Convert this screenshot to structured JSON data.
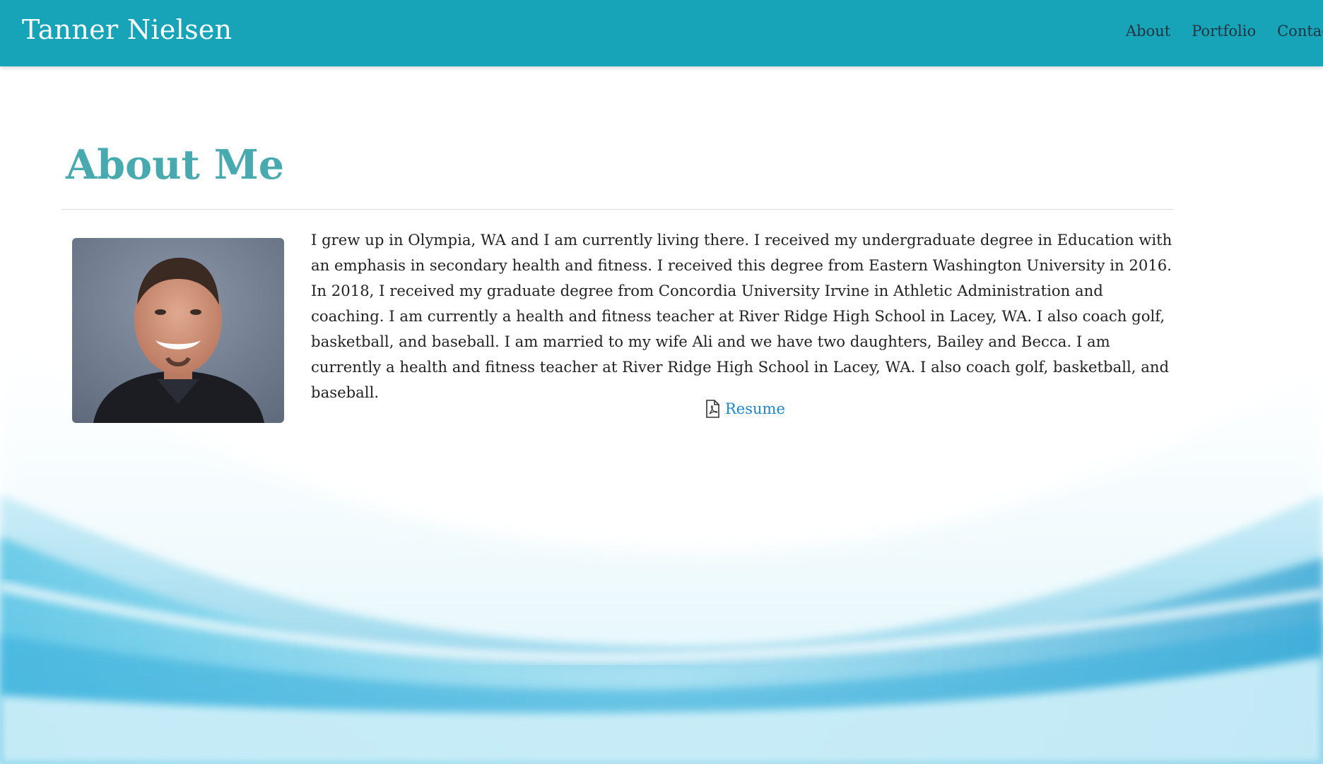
{
  "navbar": {
    "brand": "Tanner Nielsen",
    "links": [
      "About",
      "Portfolio",
      "Contact"
    ]
  },
  "about": {
    "heading": "About Me",
    "photo_alt": "Portrait photo",
    "bio": "I grew up in Olympia, WA and I am currently living there. I received my undergraduate degree in Education with an emphasis in secondary health and fitness. I received this degree from Eastern Washington University in 2016. In 2018, I received my graduate degree from Concordia University Irvine in Athletic Administration and coaching. I am currently a health and fitness teacher at River Ridge High School in Lacey, WA. I also coach golf, basketball, and baseball. I am married to my wife Ali and we have two daughters, Bailey and Becca. I am currently a health and fitness teacher at River Ridge High School in Lacey, WA. I also coach golf, basketball, and baseball.",
    "resume_label": "Resume",
    "resume_icon": "pdf-file-icon"
  },
  "colors": {
    "navbar": "#18a4b8",
    "heading": "#48a9ae",
    "link": "#1f86c6",
    "wave": "#3bb6dc"
  }
}
